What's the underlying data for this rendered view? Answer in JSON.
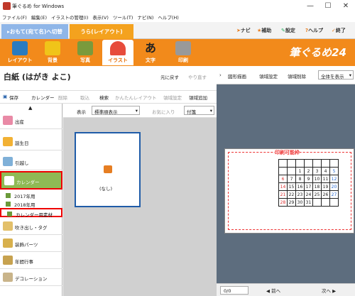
{
  "window": {
    "title": "筆ぐるめ for Windows"
  },
  "menu": [
    "ファイル(F)",
    "編集(E)",
    "イラストの管理(I)",
    "表示(V)",
    "ツール(T)",
    "ナビ(N)",
    "ヘルプ(H)"
  ],
  "tabs": {
    "front": "▸おもて(宛て名)へ切替",
    "back": "うら(レイアウト)"
  },
  "right_buttons": {
    "navi": "ナビ",
    "hojo": "補助",
    "settei": "設定",
    "help": "ヘルプ",
    "exit": "終了"
  },
  "ribbon": [
    {
      "label": "レイアウト",
      "color": "#2a7bbf"
    },
    {
      "label": "背景",
      "color": "#f0c419"
    },
    {
      "label": "写真",
      "color": "#7a9a3c"
    },
    {
      "label": "イラスト",
      "color": "#e74c3c"
    },
    {
      "label": "文字",
      "color": "#333333"
    },
    {
      "label": "印刷",
      "color": "#999999"
    }
  ],
  "logo": "筆ぐるめ24",
  "doc": {
    "title": "白紙 (はがき よこ)",
    "undo": "元に戻す",
    "redo": "やり直す"
  },
  "toolbar2": {
    "save": "保存",
    "calendar": "カレンダー",
    "delete": "削除",
    "fetch": "取込",
    "search": "検索",
    "easy": "かんたんレイアウト",
    "area_set": "領域設定",
    "area_add": "領域追加"
  },
  "sidebar": {
    "items": [
      {
        "label": "出産",
        "color": "#e98aa6"
      },
      {
        "label": "誕生日",
        "color": "#f2b134"
      },
      {
        "label": "引越し",
        "color": "#7fb0d8"
      },
      {
        "label": "カレンダー",
        "color": "#6b9a3a"
      }
    ],
    "subs": [
      "2017年用",
      "2018年用",
      "カレンダー用素材"
    ],
    "more": [
      {
        "label": "吹き出し・タグ",
        "color": "#e3c06a"
      },
      {
        "label": "装飾パーツ",
        "color": "#d8b04c"
      },
      {
        "label": "年間行事",
        "color": "#c7a24f"
      },
      {
        "label": "デコレーション",
        "color": "#c9b48a"
      }
    ]
  },
  "content": {
    "display_label": "表示",
    "display_value": "標準順表示",
    "favorite": "お気に入り",
    "tag": "付箋",
    "item_label": "(なし)"
  },
  "right": {
    "shape": "図形描画",
    "area_set": "領域設定",
    "area_delete": "領域削除",
    "show_all": "全体を表示",
    "printable": "印刷可能枠"
  },
  "status": {
    "page": "0/0",
    "prev": "前へ",
    "next": "次へ"
  },
  "calendar": {
    "rows": [
      [
        "",
        "",
        "",
        "",
        "",
        "",
        ""
      ],
      [
        "",
        "",
        "1",
        "2",
        "3",
        "4",
        "5"
      ],
      [
        "6",
        "7",
        "8",
        "9",
        "10",
        "11",
        "12"
      ],
      [
        "14",
        "15",
        "16",
        "17",
        "18",
        "19",
        "20"
      ],
      [
        "21",
        "22",
        "23",
        "24",
        "25",
        "26",
        "27"
      ],
      [
        "28",
        "29",
        "30",
        "31",
        "",
        "",
        ""
      ]
    ]
  }
}
